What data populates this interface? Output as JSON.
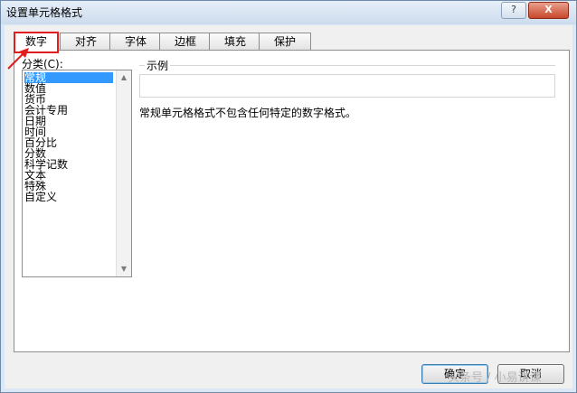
{
  "window": {
    "title": "设置单元格格式"
  },
  "title_buttons": {
    "help": "?",
    "close": "X"
  },
  "tabs": [
    {
      "label": "数字",
      "active": true
    },
    {
      "label": "对齐",
      "active": false
    },
    {
      "label": "字体",
      "active": false
    },
    {
      "label": "边框",
      "active": false
    },
    {
      "label": "填充",
      "active": false
    },
    {
      "label": "保护",
      "active": false
    }
  ],
  "category": {
    "label": "分类(C):",
    "items": [
      "常规",
      "数值",
      "货币",
      "会计专用",
      "日期",
      "时间",
      "百分比",
      "分数",
      "科学记数",
      "文本",
      "特殊",
      "自定义"
    ],
    "selected": "常规"
  },
  "sample": {
    "label": "示例",
    "value": ""
  },
  "description": "常规单元格格式不包含任何特定的数字格式。",
  "buttons": {
    "ok": "确定",
    "cancel": "取消"
  },
  "watermark": "头条号 / 小易讲课",
  "colors": {
    "accent": "#3399ff",
    "highlight_border": "#e21d1d",
    "arrow": "#e21d1d"
  },
  "icons": {
    "arrow": "red-arrow-icon",
    "scroll_up": "triangle-up-icon",
    "scroll_down": "triangle-down-icon"
  }
}
